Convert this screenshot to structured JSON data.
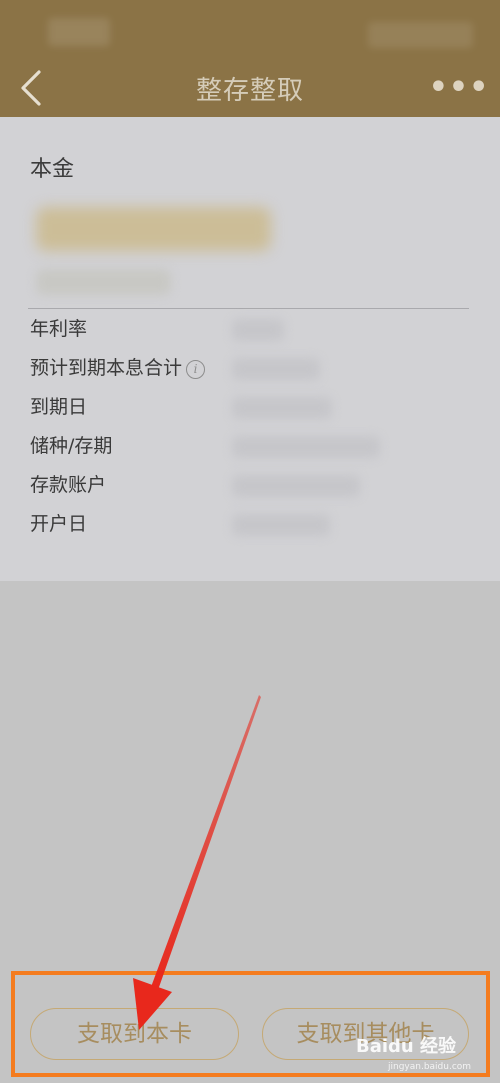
{
  "header": {
    "title": "整存整取",
    "more_label": "•••"
  },
  "deposit": {
    "principal_label": "本金",
    "principal_amount": "",
    "principal_sub": ""
  },
  "details": [
    {
      "label": "年利率",
      "value": ""
    },
    {
      "label": "预计到期本息合计",
      "value": ""
    },
    {
      "label": "到期日",
      "value": ""
    },
    {
      "label": "储种/存期",
      "value": ""
    },
    {
      "label": "存款账户",
      "value": ""
    },
    {
      "label": "开户日",
      "value": ""
    }
  ],
  "actions": {
    "withdraw_to_card": "支取到本卡",
    "withdraw_to_other": "支取到其他卡"
  },
  "watermark": {
    "text": "Baidu 经验",
    "sub": "jingyan.baidu.com"
  },
  "colors": {
    "header_bg": "#8b7346",
    "accent_gold": "#a78d5f",
    "highlight_orange": "#f47c1f",
    "arrow_red": "#e8281c"
  },
  "icons": {
    "back": "chevron-left-icon",
    "more": "ellipsis-icon",
    "info": "info-icon"
  }
}
